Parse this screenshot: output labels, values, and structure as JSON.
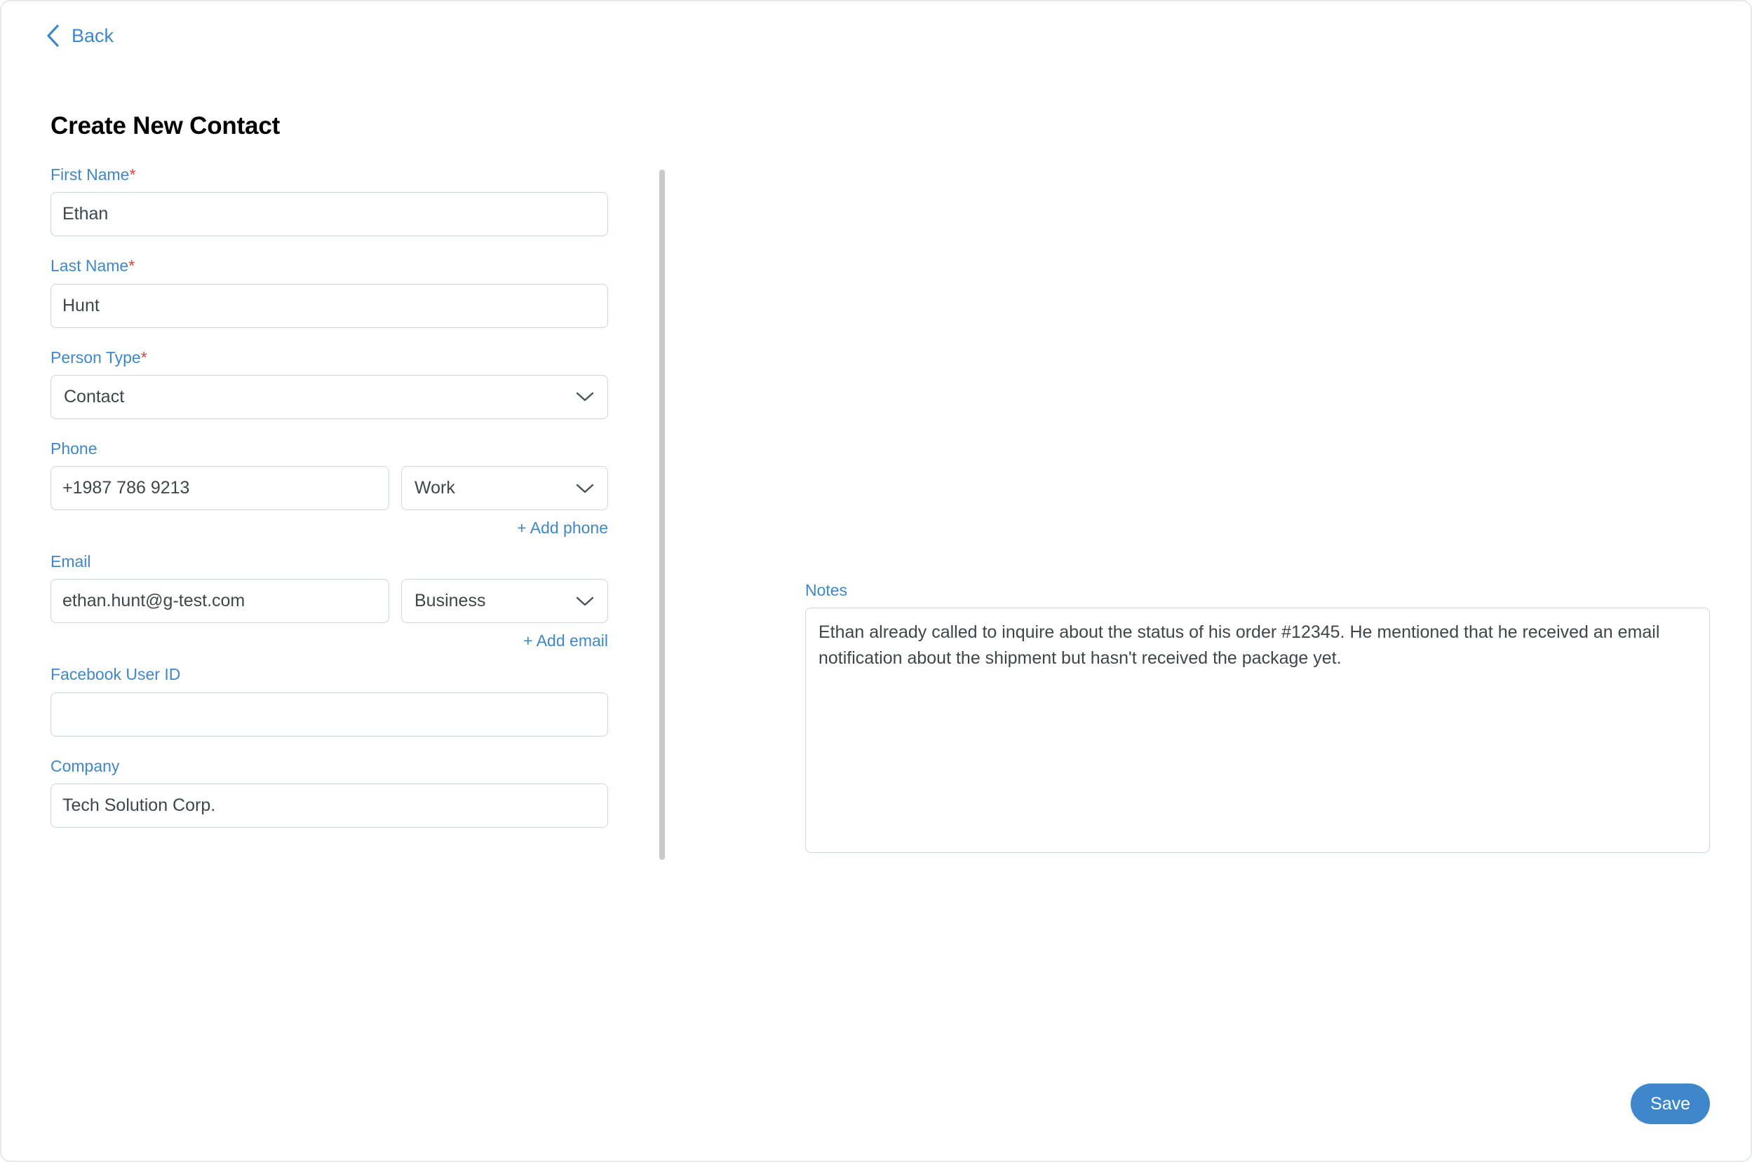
{
  "nav": {
    "back_label": "Back",
    "back_icon": "chevron-left-icon"
  },
  "header": {
    "title": "Create New Contact"
  },
  "colors": {
    "accent": "#3d87ca",
    "required_star": "#e8413c",
    "input_border": "#ced4da",
    "text": "#3f4549",
    "divider": "#c6c8ca"
  },
  "form": {
    "first_name": {
      "label": "First Name",
      "required_marker": "*",
      "value": "Ethan",
      "placeholder": ""
    },
    "last_name": {
      "label": "Last Name",
      "required_marker": "*",
      "value": "Hunt",
      "placeholder": ""
    },
    "person_type": {
      "label": "Person Type",
      "required_marker": "*",
      "value": "Contact",
      "icon": "chevron-down-icon"
    },
    "phone": {
      "label": "Phone",
      "value": "+1987 786 9213",
      "placeholder": "",
      "type_value": "Work",
      "type_icon": "chevron-down-icon",
      "add_link": "+ Add phone"
    },
    "email": {
      "label": "Email",
      "value": "ethan.hunt@g-test.com",
      "placeholder": "",
      "type_value": "Business",
      "type_icon": "chevron-down-icon",
      "add_link": "+ Add email"
    },
    "facebook_user_id": {
      "label": "Facebook User ID",
      "value": "",
      "placeholder": ""
    },
    "company": {
      "label": "Company",
      "value": "Tech Solution Corp.",
      "placeholder": ""
    }
  },
  "notes": {
    "label": "Notes",
    "value": "Ethan already called to inquire about the status of his order #12345. He mentioned that he received an email notification about the shipment but hasn't received the package yet.",
    "placeholder": ""
  },
  "footer": {
    "save_label": "Save"
  }
}
